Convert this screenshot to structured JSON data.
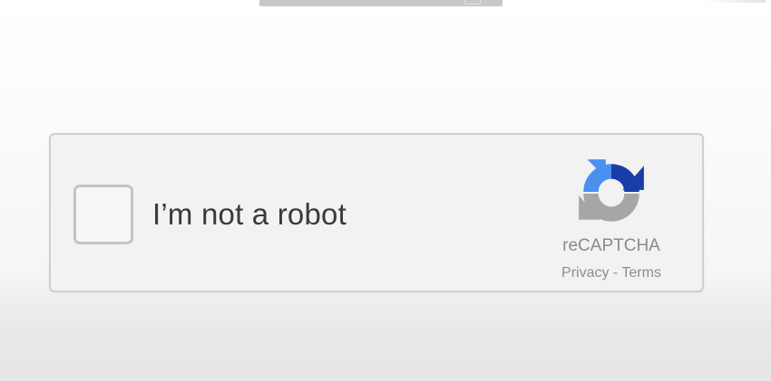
{
  "widget": {
    "label": "I’m not a robot",
    "brand": "reCAPTCHA",
    "privacy_link": "Privacy",
    "separator": " - ",
    "terms_link": "Terms",
    "checkbox_checked": false
  },
  "colors": {
    "logo_dark_blue": "#1a3da8",
    "logo_light_blue": "#4a90f0",
    "logo_gray": "#a6a6a6",
    "box_background": "#f2f2f2",
    "box_border": "#cfcfcf"
  },
  "icons": {
    "logo": "recaptcha-logo-icon"
  }
}
